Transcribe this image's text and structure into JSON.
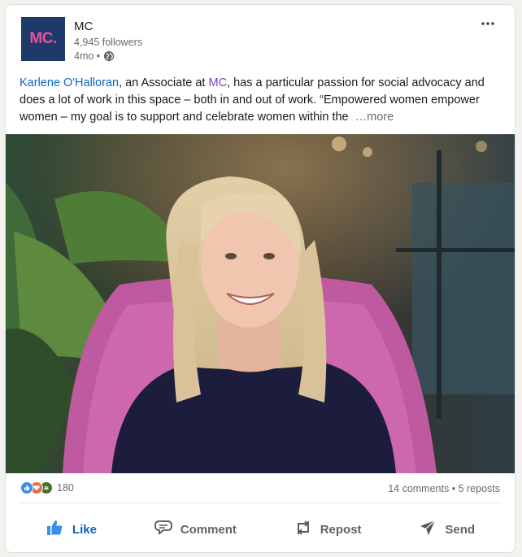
{
  "company": {
    "name": "MC",
    "logo_text": "MC.",
    "followers": "4,945 followers",
    "posted": "4mo •"
  },
  "post": {
    "person": "Karlene O'Halloran",
    "text_1": ", an Associate at ",
    "company_mention": "MC",
    "text_2": ", has a particular passion for social advocacy and does a lot of work in this space – both in and out of work. “Empowered women empower women – my goal is to support and celebrate women within the",
    "see_more": "…more"
  },
  "social": {
    "reaction_count": "180",
    "comments": "14 comments",
    "separator": "•",
    "reposts": "5 reposts"
  },
  "actions": {
    "like": "Like",
    "comment": "Comment",
    "repost": "Repost",
    "send": "Send"
  },
  "colors": {
    "brand_logo_bg": "#1e3a68",
    "brand_logo_text": "#e6529f",
    "link": "#0a66c2",
    "company_mention": "#7b3fc4"
  },
  "icons": [
    "globe-icon",
    "more-options-icon",
    "like-reaction-icon",
    "love-reaction-icon",
    "support-reaction-icon",
    "thumbs-up-icon",
    "comment-icon",
    "repost-icon",
    "send-icon"
  ]
}
